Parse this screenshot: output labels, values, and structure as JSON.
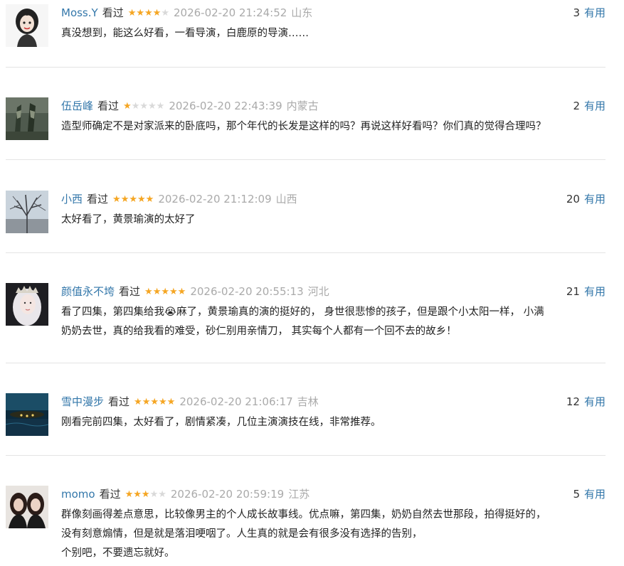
{
  "comments": [
    {
      "user": "Moss.Y",
      "watched": "看过",
      "rating": 4,
      "time": "2026-02-20 21:24:52",
      "location": "山东",
      "votes": "3",
      "useful": "有用",
      "lines": [
        "真没想到，能这么好看，一看导演，白鹿原的导演……"
      ]
    },
    {
      "user": "伍岳峰",
      "watched": "看过",
      "rating": 1,
      "time": "2026-02-20 22:43:39",
      "location": "内蒙古",
      "votes": "2",
      "useful": "有用",
      "lines": [
        "造型师确定不是对家派来的卧底吗，那个年代的长发是这样的吗？再说这样好看吗？你们真的觉得合理吗？"
      ]
    },
    {
      "user": "小西",
      "watched": "看过",
      "rating": 5,
      "time": "2026-02-20 21:12:09",
      "location": "山西",
      "votes": "20",
      "useful": "有用",
      "lines": [
        "太好看了，黄景瑜演的太好了"
      ]
    },
    {
      "user": "颜值永不垮",
      "watched": "看过",
      "rating": 5,
      "time": "2026-02-20 20:55:13",
      "location": "河北",
      "votes": "21",
      "useful": "有用",
      "lines": [
        "看了四集，第四集给我😭麻了，黄景瑜真的演的挺好的， 身世很悲惨的孩子，但是跟个小太阳一样， 小满",
        "奶奶去世，真的给我看的难受，砂仁别用亲情刀， 其实每个人都有一个回不去的故乡！"
      ]
    },
    {
      "user": "雪中漫步",
      "watched": "看过",
      "rating": 5,
      "time": "2026-02-20 21:06:17",
      "location": "吉林",
      "votes": "12",
      "useful": "有用",
      "lines": [
        "刚看完前四集，太好看了，剧情紧凑，几位主演演技在线，非常推荐。"
      ]
    },
    {
      "user": "momo",
      "watched": "看过",
      "rating": 3,
      "time": "2026-02-20 20:59:19",
      "location": "江苏",
      "votes": "5",
      "useful": "有用",
      "lines": [
        "群像刻画得差点意思，比较像男主的个人成长故事线。优点嘛，第四集，奶奶自然去世那段，拍得挺好的，",
        "没有刻意煽情，但是就是落泪哽咽了。人生真的就是会有很多没有选择的告别，",
        "个别吧，不要遗忘就好。"
      ]
    }
  ],
  "colors": {
    "link": "#3377aa",
    "star_on": "#f5a623",
    "star_off": "#d9d9d9",
    "meta_gray": "#aaaaaa",
    "divider": "#e4e4e4"
  }
}
